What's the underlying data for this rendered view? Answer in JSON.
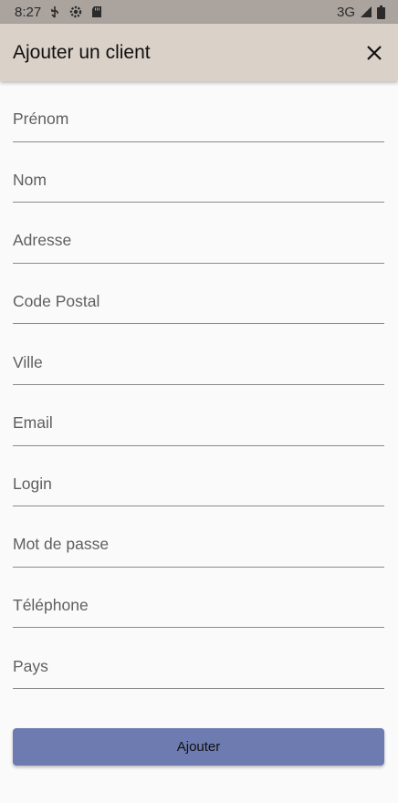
{
  "status_bar": {
    "time": "8:27",
    "network": "3G",
    "icons": [
      "usb-icon",
      "settings-gear-icon",
      "sd-card-icon",
      "signal-icon",
      "battery-icon"
    ]
  },
  "app_bar": {
    "title": "Ajouter un client",
    "close_icon": "close-icon"
  },
  "form": {
    "fields": [
      {
        "placeholder": "Prénom",
        "value": ""
      },
      {
        "placeholder": "Nom",
        "value": ""
      },
      {
        "placeholder": "Adresse",
        "value": ""
      },
      {
        "placeholder": "Code Postal",
        "value": ""
      },
      {
        "placeholder": "Ville",
        "value": ""
      },
      {
        "placeholder": "Email",
        "value": ""
      },
      {
        "placeholder": "Login",
        "value": ""
      },
      {
        "placeholder": "Mot de passe",
        "value": ""
      },
      {
        "placeholder": "Téléphone",
        "value": ""
      },
      {
        "placeholder": "Pays",
        "value": ""
      }
    ],
    "submit_label": "Ajouter"
  },
  "colors": {
    "status_bar": "#aaa39e",
    "app_bar": "#dad1c8",
    "background": "#fafafa",
    "button": "#6d7bb0"
  }
}
